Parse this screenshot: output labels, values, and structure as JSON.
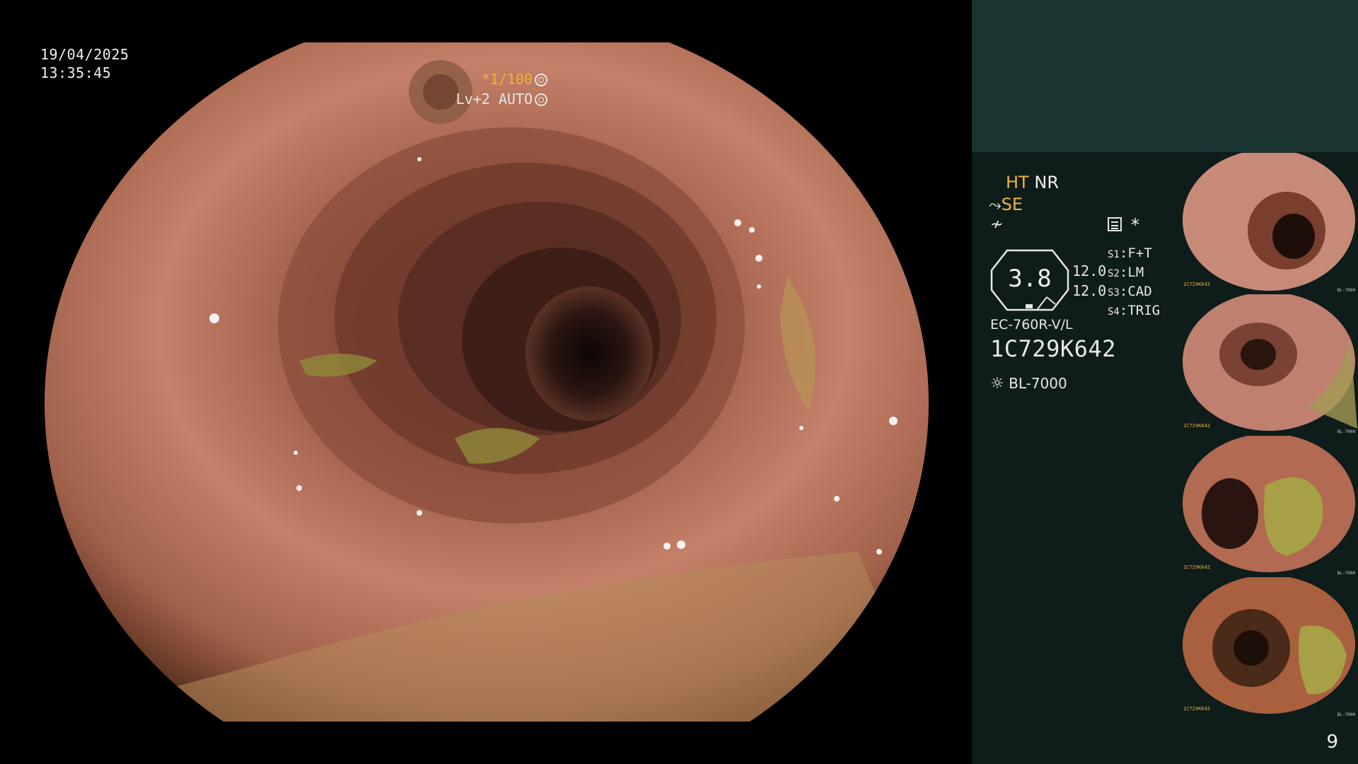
{
  "overlay": {
    "date": "19/04/2025",
    "time": "13:35:45",
    "shutter": "*1/100",
    "level": "Lv+2",
    "mode": "AUTO"
  },
  "panel": {
    "ht": "HT",
    "nr": "NR",
    "se": "SE",
    "gauge_value": "3.8",
    "num1": "12.0",
    "num2": "12.0",
    "settings": [
      {
        "key": "S1",
        "value": "F+T"
      },
      {
        "key": "S2",
        "value": "LM"
      },
      {
        "key": "S3",
        "value": "CAD"
      },
      {
        "key": "S4",
        "value": "TRIG"
      }
    ],
    "star": "*",
    "model": "EC-760R-V/L",
    "serial": "1C729K642",
    "light_source": "BL-7000",
    "page_number": "9"
  },
  "thumbnails": [
    {
      "label": "1C729K642",
      "right": "BL-7000"
    },
    {
      "label": "1C729K642",
      "right": "BL-7000"
    },
    {
      "label": "1C729K642",
      "right": "BL-7000"
    },
    {
      "label": "1C729K642",
      "right": "BL-7000"
    }
  ]
}
